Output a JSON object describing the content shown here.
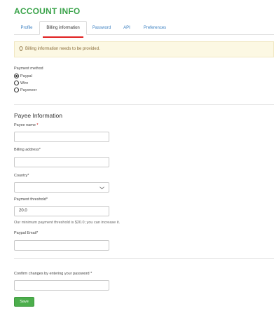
{
  "page": {
    "title": "ACCOUNT INFO"
  },
  "tabs": [
    {
      "label": "Profile",
      "active": false
    },
    {
      "label": "Billing information",
      "active": true
    },
    {
      "label": "Password",
      "active": false
    },
    {
      "label": "API",
      "active": false
    },
    {
      "label": "Preferences",
      "active": false
    }
  ],
  "alert": {
    "icon": "lightbulb-icon",
    "text": "Billing information needs to be provided.",
    "bg_color": "#fcf8e3"
  },
  "payment_method": {
    "label": "Payment method",
    "options": [
      {
        "label": "Paypal",
        "checked": true
      },
      {
        "label": "Wire",
        "checked": false
      },
      {
        "label": "Payoneer",
        "checked": false
      }
    ]
  },
  "payee": {
    "section_title": "Payee Information",
    "payee_name": {
      "label": "Payee name",
      "required_mark": "*",
      "value": ""
    },
    "billing_address": {
      "label": "Billing address*",
      "value": ""
    },
    "country": {
      "label": "Country*",
      "value": "",
      "chevron_icon": "chevron-down-icon"
    },
    "payment_threshold": {
      "label": "Payment threshold*",
      "value": "20.0",
      "help": "Our minimum payment threshold is $20.0; you can increase it."
    },
    "paypal_email": {
      "label": "Paypal Email*",
      "value": ""
    }
  },
  "confirm": {
    "label": "Confirm changes by entering your password *",
    "value": ""
  },
  "actions": {
    "save_label": "Save",
    "save_color": "#4cae4c"
  },
  "colors": {
    "accent": "#3aa34a",
    "link": "#3a7fc1",
    "active_tab_underline": "#e02020"
  }
}
